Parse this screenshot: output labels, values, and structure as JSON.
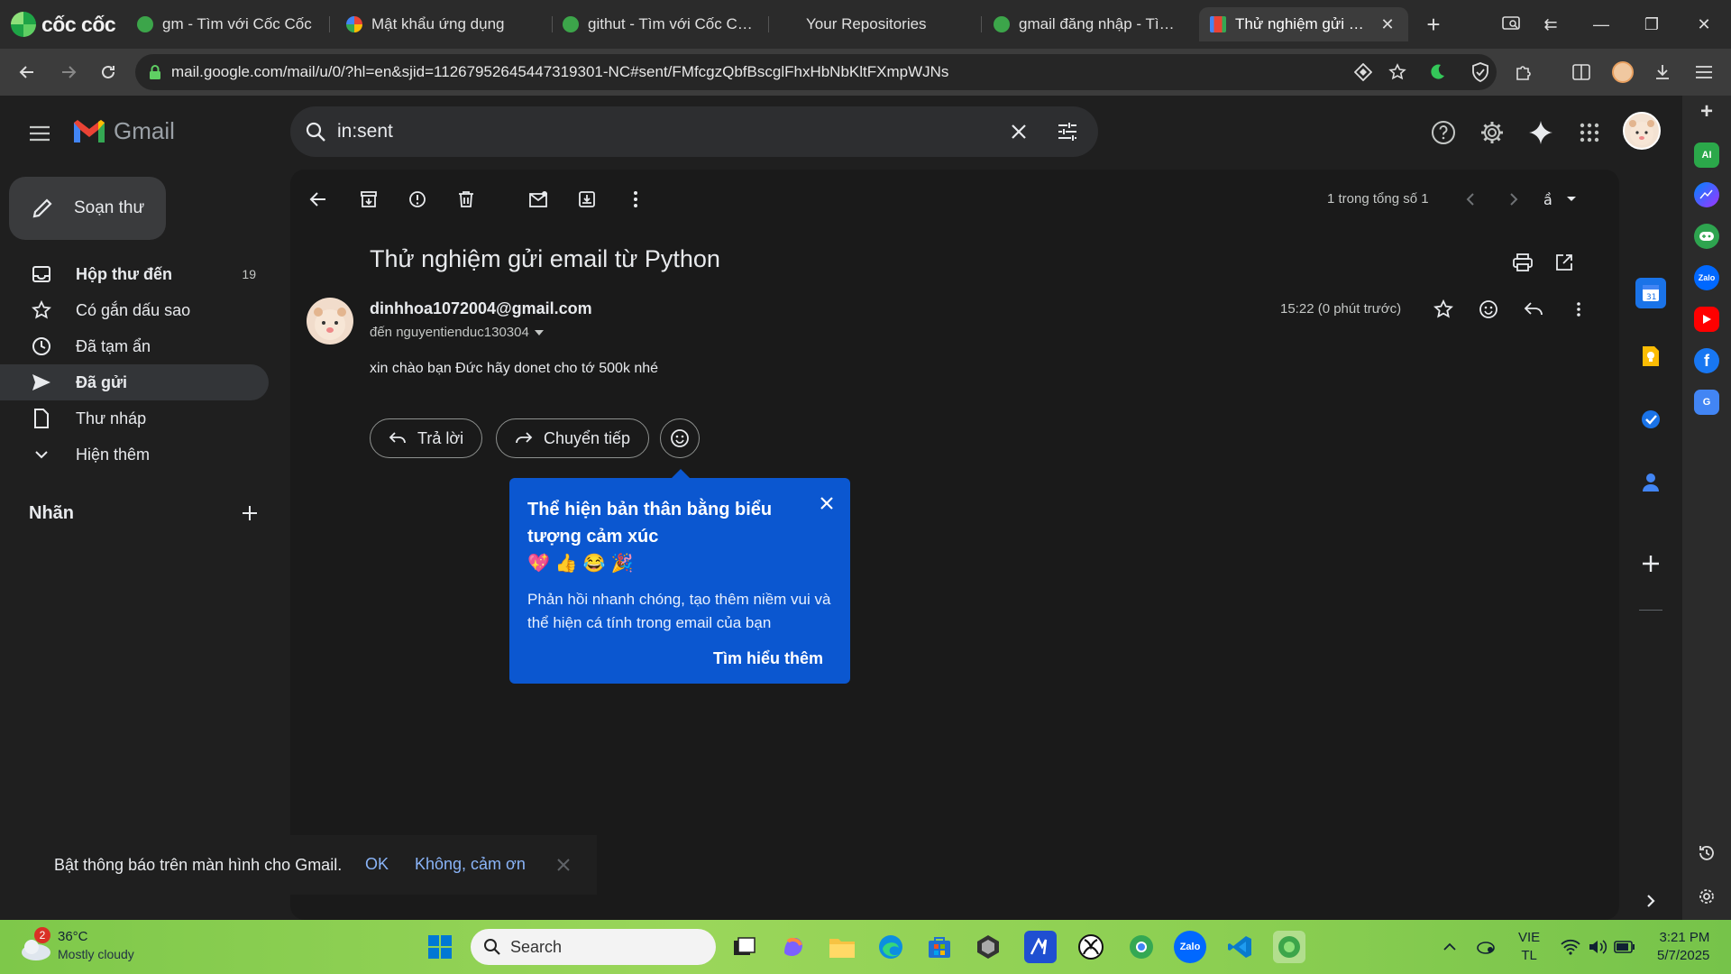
{
  "browser": {
    "brand": "cốc cốc",
    "tabs": [
      {
        "label": "gm - Tìm với Cốc Cốc",
        "icon": "coccoc-icon"
      },
      {
        "label": "Mật khẩu ứng dụng",
        "icon": "google-icon"
      },
      {
        "label": "githut - Tìm với Cốc Cốc",
        "icon": "coccoc-icon"
      },
      {
        "label": "Your Repositories",
        "icon": "none"
      },
      {
        "label": "gmail đăng nhập - Tìm vớ",
        "icon": "coccoc-icon"
      },
      {
        "label": "Thử nghiệm gửi ema",
        "icon": "gmail-icon",
        "active": true
      }
    ],
    "url": "mail.google.com/mail/u/0/?hl=en&sjid=11267952645447319301-NC#sent/FMfcgzQbfBscglFhxHbNbKltFXmpWJNs"
  },
  "gmail": {
    "logo_text": "Gmail",
    "search_value": "in:sent",
    "compose_label": "Soạn thư",
    "nav": [
      {
        "label": "Hộp thư đến",
        "count": "19",
        "icon": "inbox-icon",
        "bold": true
      },
      {
        "label": "Có gắn dấu sao",
        "count": "",
        "icon": "star-icon"
      },
      {
        "label": "Đã tạm ẩn",
        "count": "",
        "icon": "clock-icon"
      },
      {
        "label": "Đã gửi",
        "count": "",
        "icon": "send-icon",
        "active": true
      },
      {
        "label": "Thư nháp",
        "count": "",
        "icon": "draft-icon"
      },
      {
        "label": "Hiện thêm",
        "count": "",
        "icon": "chevron-down-icon"
      }
    ],
    "labels_heading": "Nhãn",
    "pager": "1 trong tổng số 1",
    "email": {
      "subject": "Thử nghiệm gửi email từ Python",
      "sender": "dinhhoa1072004@gmail.com",
      "recipient": "đến nguyentienduc130304",
      "time": "15:22 (0 phút trước)",
      "body": "xin chào bạn Đức hãy donet cho tớ 500k nhé"
    },
    "actions": {
      "reply": "Trả lời",
      "forward": "Chuyển tiếp"
    },
    "popup": {
      "title": "Thể hiện bản thân bằng biểu tượng cảm xúc",
      "emojis": "💖👍😂🎉",
      "text": "Phản hồi nhanh chóng, tạo thêm niềm vui và thể hiện cá tính trong email của bạn",
      "link": "Tìm hiểu thêm"
    },
    "toast": {
      "text": "Bật thông báo trên màn hình cho Gmail.",
      "ok": "OK",
      "no": "Không, cảm ơn"
    }
  },
  "taskbar": {
    "weather_temp": "36°C",
    "weather_cond": "Mostly cloudy",
    "weather_badge": "2",
    "search_label": "Search",
    "lang_line1": "VIE",
    "lang_line2": "TL",
    "time": "3:21 PM",
    "date": "5/7/2025"
  },
  "colors": {
    "gmail_bg": "#1f1f1f",
    "popup_bg": "#0b57d0",
    "link": "#8ab4f8",
    "taskbar": "#8ccf52"
  }
}
